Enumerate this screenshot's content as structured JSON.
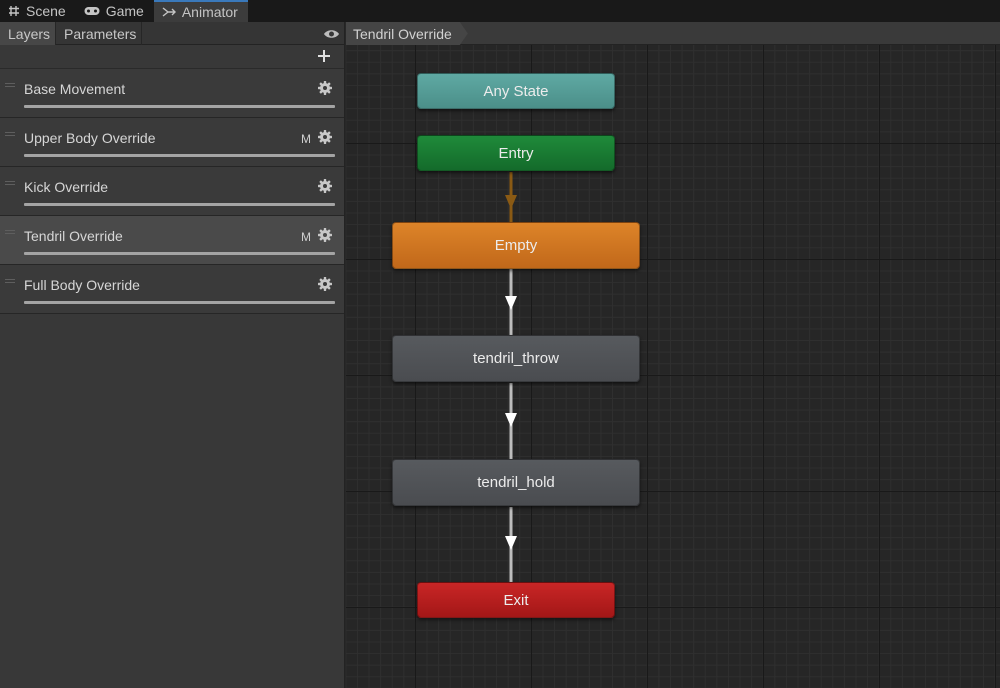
{
  "tabs": [
    {
      "label": "Scene",
      "icon": "grid-icon"
    },
    {
      "label": "Game",
      "icon": "gamepad-icon"
    },
    {
      "label": "Animator",
      "icon": "animator-icon",
      "active": true
    }
  ],
  "left_panel": {
    "subtabs": [
      {
        "label": "Layers",
        "active": true
      },
      {
        "label": "Parameters"
      }
    ],
    "layers": [
      {
        "name": "Base Movement",
        "marker": ""
      },
      {
        "name": "Upper Body Override",
        "marker": "M"
      },
      {
        "name": "Kick Override",
        "marker": ""
      },
      {
        "name": "Tendril Override",
        "marker": "M",
        "selected": true
      },
      {
        "name": "Full Body Override",
        "marker": ""
      }
    ]
  },
  "graph": {
    "breadcrumb": "Tendril Override",
    "nodes": {
      "any_state": "Any State",
      "entry": "Entry",
      "empty": "Empty",
      "tendril_throw": "tendril_throw",
      "tendril_hold": "tendril_hold",
      "exit": "Exit"
    }
  },
  "colors": {
    "any_state": "#5fa9a3",
    "entry": "#1f8a3a",
    "default_state": "#dd8429",
    "state": "#575a5e",
    "exit": "#c92626",
    "selected_tab_accent": "#3a79bb"
  }
}
